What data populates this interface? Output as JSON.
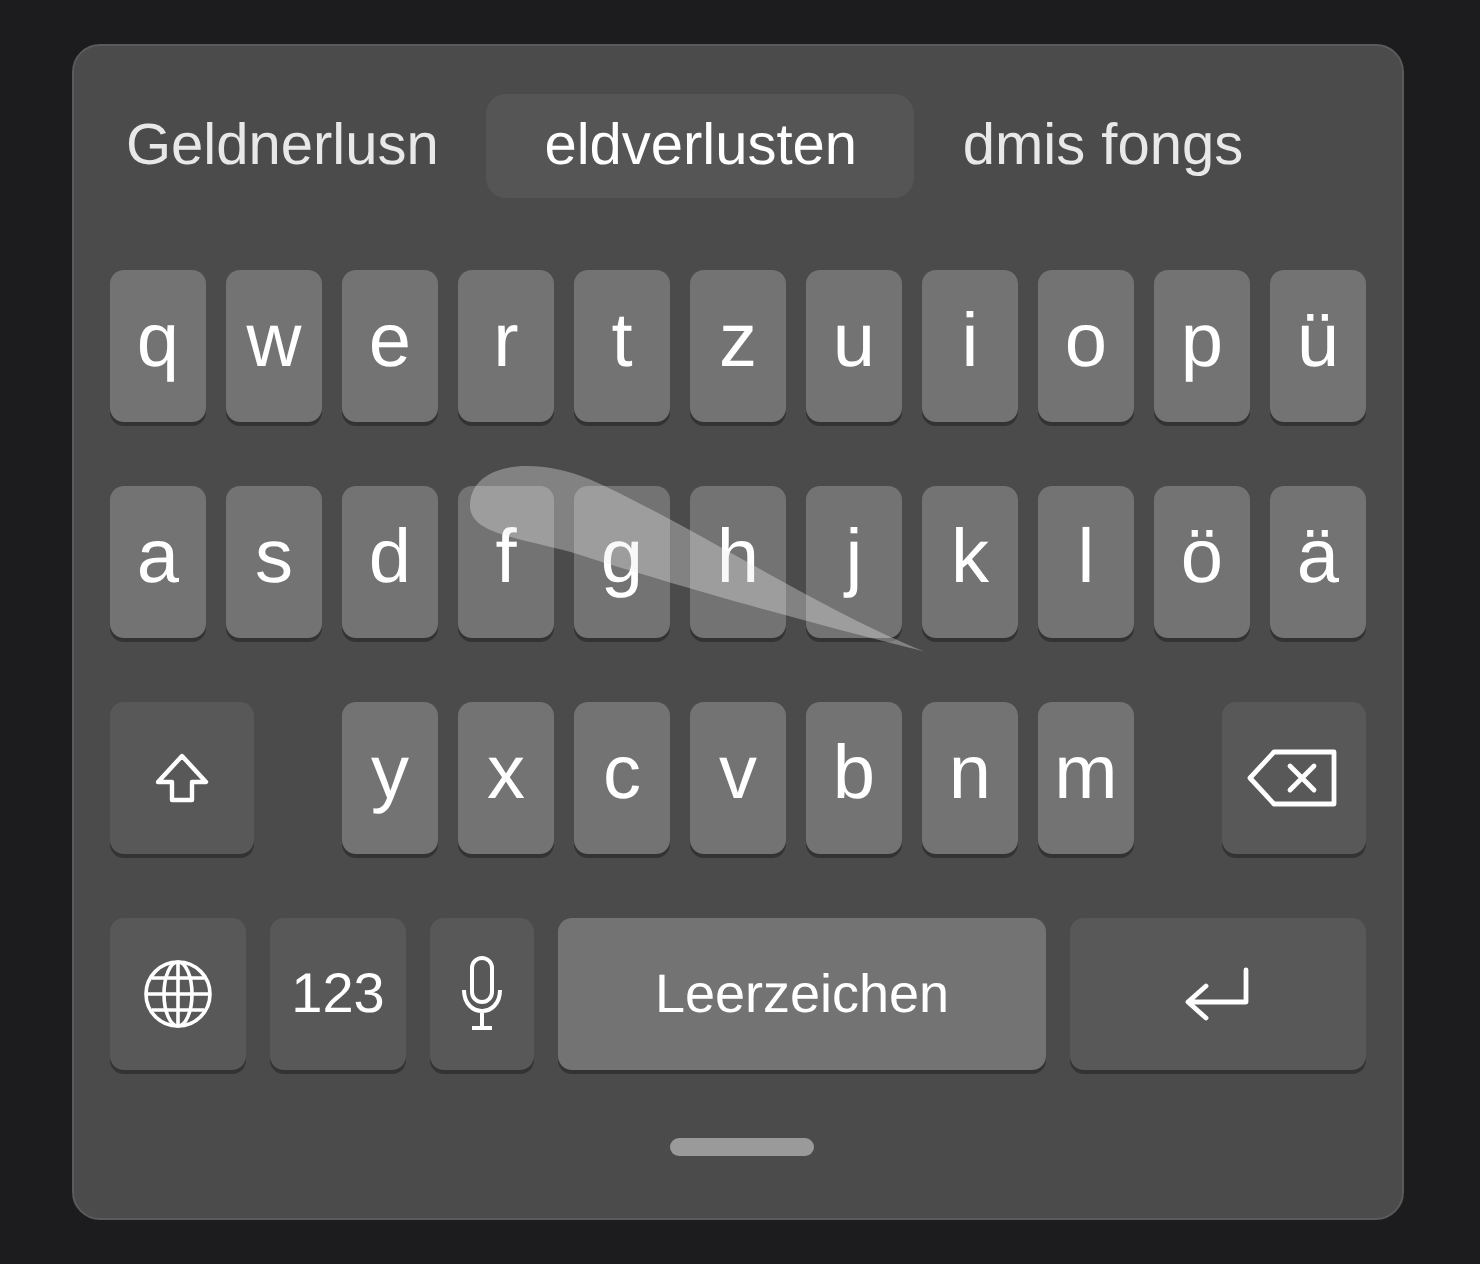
{
  "suggestions": [
    {
      "label": "Geldnerlusn",
      "selected": false
    },
    {
      "label": "eldverlusten",
      "selected": true
    },
    {
      "label": "dmis fongs",
      "selected": false
    }
  ],
  "rows": [
    {
      "kind": "letters",
      "keys": [
        {
          "kind": "letter",
          "label": "q"
        },
        {
          "kind": "letter",
          "label": "w"
        },
        {
          "kind": "letter",
          "label": "e"
        },
        {
          "kind": "letter",
          "label": "r"
        },
        {
          "kind": "letter",
          "label": "t"
        },
        {
          "kind": "letter",
          "label": "z"
        },
        {
          "kind": "letter",
          "label": "u"
        },
        {
          "kind": "letter",
          "label": "i"
        },
        {
          "kind": "letter",
          "label": "o"
        },
        {
          "kind": "letter",
          "label": "p"
        },
        {
          "kind": "letter",
          "label": "ü"
        }
      ]
    },
    {
      "kind": "letters",
      "keys": [
        {
          "kind": "letter",
          "label": "a"
        },
        {
          "kind": "letter",
          "label": "s"
        },
        {
          "kind": "letter",
          "label": "d"
        },
        {
          "kind": "letter",
          "label": "f"
        },
        {
          "kind": "letter",
          "label": "g"
        },
        {
          "kind": "letter",
          "label": "h"
        },
        {
          "kind": "letter",
          "label": "j"
        },
        {
          "kind": "letter",
          "label": "k"
        },
        {
          "kind": "letter",
          "label": "l"
        },
        {
          "kind": "letter",
          "label": "ö"
        },
        {
          "kind": "letter",
          "label": "ä"
        }
      ]
    },
    {
      "kind": "shift-row",
      "keys": [
        {
          "kind": "shift"
        },
        {
          "kind": "letter",
          "label": "y"
        },
        {
          "kind": "letter",
          "label": "x"
        },
        {
          "kind": "letter",
          "label": "c"
        },
        {
          "kind": "letter",
          "label": "v"
        },
        {
          "kind": "letter",
          "label": "b"
        },
        {
          "kind": "letter",
          "label": "n"
        },
        {
          "kind": "letter",
          "label": "m"
        },
        {
          "kind": "backspace"
        }
      ]
    },
    {
      "kind": "bottom",
      "keys": [
        {
          "kind": "globe"
        },
        {
          "kind": "numbers",
          "label": "123"
        },
        {
          "kind": "mic"
        },
        {
          "kind": "space",
          "label": "Leerzeichen"
        },
        {
          "kind": "return"
        }
      ]
    }
  ]
}
